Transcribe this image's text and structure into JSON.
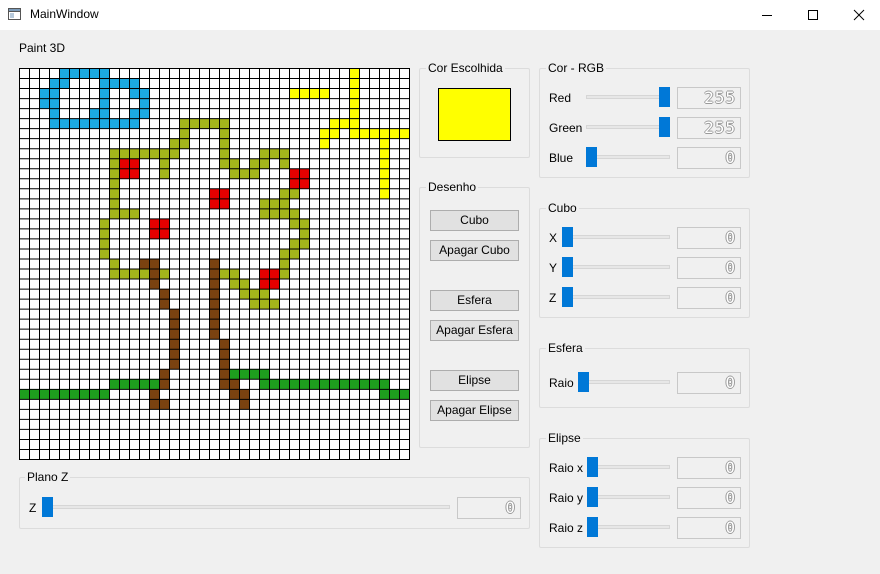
{
  "window": {
    "title": "MainWindow",
    "controls": {
      "minimize": "minimize",
      "maximize": "maximize",
      "close": "close"
    }
  },
  "canvas": {
    "label": "Paint 3D",
    "grid_cols": 39,
    "grid_rows": 39,
    "colors": {
      "cyan": "#1ba9e1",
      "yellow": "#ffff00",
      "olive": "#a4b51b",
      "red": "#e60000",
      "brown": "#7a4210",
      "green": "#1e9e1e"
    },
    "cells": {
      "cyan": [
        [
          4,
          0
        ],
        [
          5,
          0
        ],
        [
          6,
          0
        ],
        [
          7,
          0
        ],
        [
          8,
          0
        ],
        [
          3,
          1
        ],
        [
          4,
          1
        ],
        [
          8,
          1
        ],
        [
          9,
          1
        ],
        [
          10,
          1
        ],
        [
          11,
          1
        ],
        [
          2,
          2
        ],
        [
          3,
          2
        ],
        [
          8,
          2
        ],
        [
          11,
          2
        ],
        [
          12,
          2
        ],
        [
          2,
          3
        ],
        [
          3,
          3
        ],
        [
          8,
          3
        ],
        [
          12,
          3
        ],
        [
          12,
          3
        ],
        [
          3,
          4
        ],
        [
          7,
          4
        ],
        [
          8,
          4
        ],
        [
          11,
          4
        ],
        [
          12,
          4
        ],
        [
          3,
          5
        ],
        [
          4,
          5
        ],
        [
          5,
          5
        ],
        [
          6,
          5
        ],
        [
          7,
          5
        ],
        [
          8,
          5
        ],
        [
          9,
          5
        ],
        [
          10,
          5
        ],
        [
          11,
          5
        ]
      ],
      "yellow": [
        [
          33,
          0
        ],
        [
          33,
          1
        ],
        [
          27,
          2
        ],
        [
          28,
          2
        ],
        [
          29,
          2
        ],
        [
          30,
          2
        ],
        [
          33,
          2
        ],
        [
          33,
          3
        ],
        [
          33,
          4
        ],
        [
          33,
          5
        ],
        [
          31,
          5
        ],
        [
          32,
          5
        ],
        [
          30,
          6
        ],
        [
          31,
          6
        ],
        [
          33,
          6
        ],
        [
          34,
          6
        ],
        [
          35,
          6
        ],
        [
          36,
          6
        ],
        [
          37,
          6
        ],
        [
          38,
          6
        ],
        [
          30,
          7
        ],
        [
          36,
          7
        ],
        [
          36,
          8
        ],
        [
          36,
          9
        ],
        [
          36,
          10
        ],
        [
          36,
          11
        ],
        [
          36,
          12
        ]
      ],
      "olive": [
        [
          16,
          5
        ],
        [
          17,
          5
        ],
        [
          18,
          5
        ],
        [
          19,
          5
        ],
        [
          20,
          5
        ],
        [
          16,
          6
        ],
        [
          20,
          6
        ],
        [
          15,
          7
        ],
        [
          16,
          7
        ],
        [
          20,
          7
        ],
        [
          9,
          8
        ],
        [
          10,
          8
        ],
        [
          11,
          8
        ],
        [
          12,
          8
        ],
        [
          13,
          8
        ],
        [
          14,
          8
        ],
        [
          15,
          8
        ],
        [
          20,
          8
        ],
        [
          24,
          8
        ],
        [
          25,
          8
        ],
        [
          26,
          8
        ],
        [
          9,
          9
        ],
        [
          14,
          9
        ],
        [
          20,
          9
        ],
        [
          21,
          9
        ],
        [
          23,
          9
        ],
        [
          24,
          9
        ],
        [
          26,
          9
        ],
        [
          9,
          10
        ],
        [
          14,
          10
        ],
        [
          21,
          10
        ],
        [
          22,
          10
        ],
        [
          23,
          10
        ],
        [
          27,
          10
        ],
        [
          9,
          11
        ],
        [
          27,
          11
        ],
        [
          9,
          12
        ],
        [
          26,
          12
        ],
        [
          27,
          12
        ],
        [
          9,
          13
        ],
        [
          24,
          13
        ],
        [
          25,
          13
        ],
        [
          26,
          13
        ],
        [
          9,
          14
        ],
        [
          10,
          14
        ],
        [
          11,
          14
        ],
        [
          24,
          14
        ],
        [
          25,
          14
        ],
        [
          26,
          14
        ],
        [
          27,
          14
        ],
        [
          8,
          15
        ],
        [
          27,
          15
        ],
        [
          28,
          15
        ],
        [
          8,
          16
        ],
        [
          28,
          16
        ],
        [
          8,
          17
        ],
        [
          27,
          17
        ],
        [
          28,
          17
        ],
        [
          8,
          18
        ],
        [
          26,
          18
        ],
        [
          27,
          18
        ],
        [
          9,
          19
        ],
        [
          26,
          19
        ],
        [
          9,
          20
        ],
        [
          10,
          20
        ],
        [
          11,
          20
        ],
        [
          12,
          20
        ],
        [
          13,
          20
        ],
        [
          14,
          20
        ],
        [
          20,
          20
        ],
        [
          21,
          20
        ],
        [
          25,
          20
        ],
        [
          26,
          20
        ],
        [
          21,
          21
        ],
        [
          22,
          21
        ],
        [
          25,
          21
        ],
        [
          22,
          22
        ],
        [
          23,
          22
        ],
        [
          24,
          22
        ],
        [
          23,
          23
        ],
        [
          24,
          23
        ],
        [
          25,
          23
        ]
      ],
      "red": [
        [
          10,
          9
        ],
        [
          11,
          9
        ],
        [
          10,
          10
        ],
        [
          11,
          10
        ],
        [
          27,
          10
        ],
        [
          28,
          10
        ],
        [
          27,
          11
        ],
        [
          28,
          11
        ],
        [
          19,
          12
        ],
        [
          20,
          12
        ],
        [
          19,
          13
        ],
        [
          20,
          13
        ],
        [
          13,
          15
        ],
        [
          14,
          15
        ],
        [
          13,
          16
        ],
        [
          14,
          16
        ],
        [
          24,
          20
        ],
        [
          25,
          20
        ],
        [
          24,
          21
        ],
        [
          25,
          21
        ]
      ],
      "brown": [
        [
          12,
          19
        ],
        [
          13,
          19
        ],
        [
          19,
          19
        ],
        [
          13,
          20
        ],
        [
          19,
          20
        ],
        [
          13,
          21
        ],
        [
          19,
          21
        ],
        [
          14,
          22
        ],
        [
          19,
          22
        ],
        [
          14,
          23
        ],
        [
          19,
          23
        ],
        [
          15,
          24
        ],
        [
          19,
          24
        ],
        [
          15,
          25
        ],
        [
          19,
          25
        ],
        [
          15,
          26
        ],
        [
          19,
          26
        ],
        [
          15,
          27
        ],
        [
          20,
          27
        ],
        [
          15,
          28
        ],
        [
          20,
          28
        ],
        [
          15,
          29
        ],
        [
          20,
          29
        ],
        [
          14,
          30
        ],
        [
          20,
          30
        ],
        [
          14,
          31
        ],
        [
          20,
          31
        ],
        [
          21,
          31
        ],
        [
          13,
          32
        ],
        [
          21,
          32
        ],
        [
          22,
          32
        ],
        [
          13,
          33
        ],
        [
          14,
          33
        ],
        [
          22,
          33
        ]
      ],
      "green": [
        [
          21,
          30
        ],
        [
          22,
          30
        ],
        [
          23,
          30
        ],
        [
          24,
          30
        ],
        [
          9,
          31
        ],
        [
          10,
          31
        ],
        [
          11,
          31
        ],
        [
          12,
          31
        ],
        [
          13,
          31
        ],
        [
          24,
          31
        ],
        [
          25,
          31
        ],
        [
          26,
          31
        ],
        [
          27,
          31
        ],
        [
          28,
          31
        ],
        [
          29,
          31
        ],
        [
          30,
          31
        ],
        [
          31,
          31
        ],
        [
          32,
          31
        ],
        [
          33,
          31
        ],
        [
          34,
          31
        ],
        [
          35,
          31
        ],
        [
          36,
          31
        ],
        [
          0,
          32
        ],
        [
          1,
          32
        ],
        [
          2,
          32
        ],
        [
          3,
          32
        ],
        [
          4,
          32
        ],
        [
          5,
          32
        ],
        [
          6,
          32
        ],
        [
          7,
          32
        ],
        [
          8,
          32
        ],
        [
          36,
          32
        ],
        [
          37,
          32
        ],
        [
          38,
          32
        ]
      ]
    }
  },
  "chosen_color": {
    "title": "Cor Escolhida",
    "value": "#ffff00"
  },
  "drawing": {
    "title": "Desenho",
    "buttons": {
      "cubo": "Cubo",
      "apagar_cubo": "Apagar Cubo",
      "esfera": "Esfera",
      "apagar_esfera": "Apagar Esfera",
      "elipse": "Elipse",
      "apagar_elipse": "Apagar Elipse"
    }
  },
  "rgb": {
    "title": "Cor - RGB",
    "red": {
      "label": "Red",
      "value": 255,
      "display": "255"
    },
    "green": {
      "label": "Green",
      "value": 255,
      "display": "255"
    },
    "blue": {
      "label": "Blue",
      "value": 0,
      "display": "0"
    }
  },
  "cubo": {
    "title": "Cubo",
    "x": {
      "label": "X",
      "value": 0,
      "display": "0"
    },
    "y": {
      "label": "Y",
      "value": 0,
      "display": "0"
    },
    "z": {
      "label": "Z",
      "value": 0,
      "display": "0"
    }
  },
  "esfera": {
    "title": "Esfera",
    "raio": {
      "label": "Raio",
      "value": 0,
      "display": "0"
    }
  },
  "elipse": {
    "title": "Elipse",
    "raio_x": {
      "label": "Raio x",
      "value": 0,
      "display": "0"
    },
    "raio_y": {
      "label": "Raio y",
      "value": 0,
      "display": "0"
    },
    "raio_z": {
      "label": "Raio z",
      "value": 0,
      "display": "0"
    }
  },
  "plano_z": {
    "title": "Plano Z",
    "z": {
      "label": "Z",
      "value": 0,
      "display": "0"
    }
  }
}
